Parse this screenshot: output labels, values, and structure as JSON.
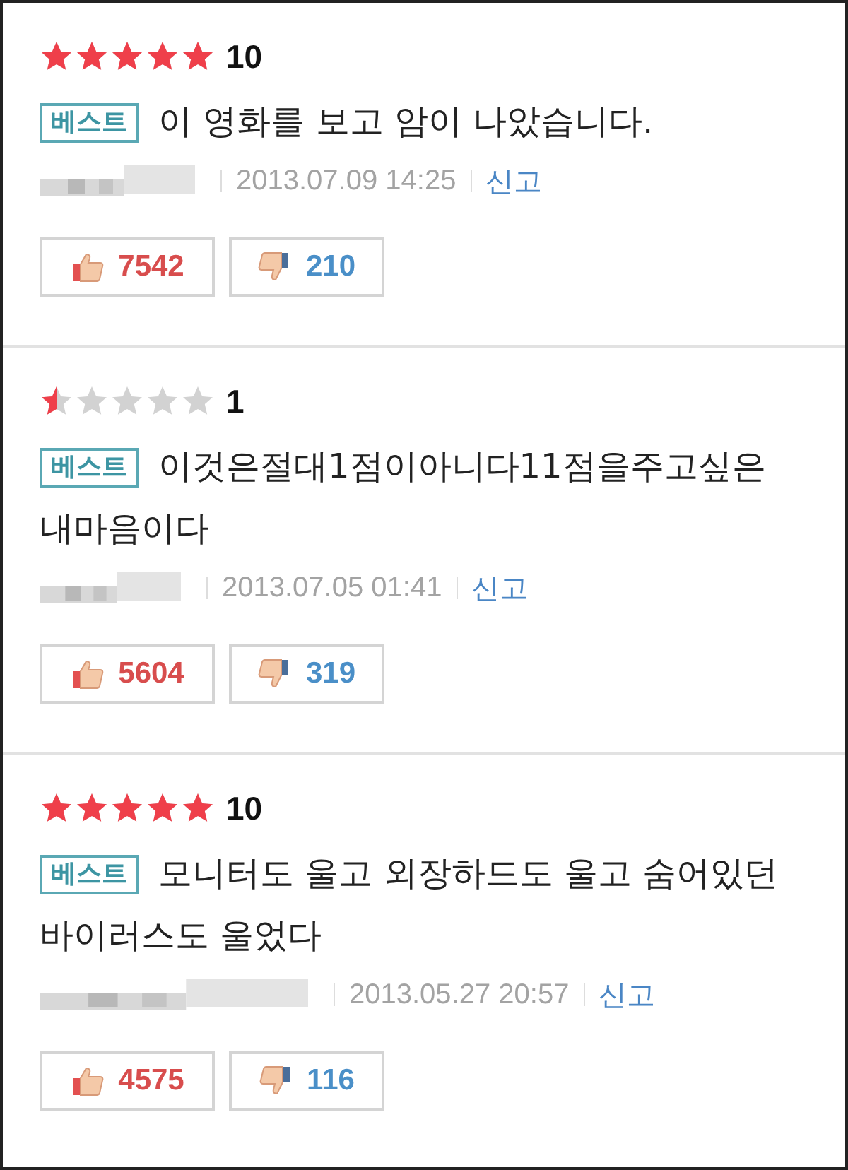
{
  "reviews": [
    {
      "stars": 5,
      "score": "10",
      "badge": "베스트",
      "text": "이 영화를 보고 암이 나았습니다.",
      "date": "2013.07.09 14:25",
      "report": "신고",
      "likes": "7542",
      "dislikes": "210"
    },
    {
      "stars": 0.5,
      "score": "1",
      "badge": "베스트",
      "text": "이것은절대1점이아니다11점을주고싶은 내마음이다",
      "date": "2013.07.05 01:41",
      "report": "신고",
      "likes": "5604",
      "dislikes": "319"
    },
    {
      "stars": 5,
      "score": "10",
      "badge": "베스트",
      "text": "모니터도 울고 외장하드도 울고 숨어있던 바이러스도 울었다",
      "date": "2013.05.27 20:57",
      "report": "신고",
      "likes": "4575",
      "dislikes": "116"
    }
  ]
}
